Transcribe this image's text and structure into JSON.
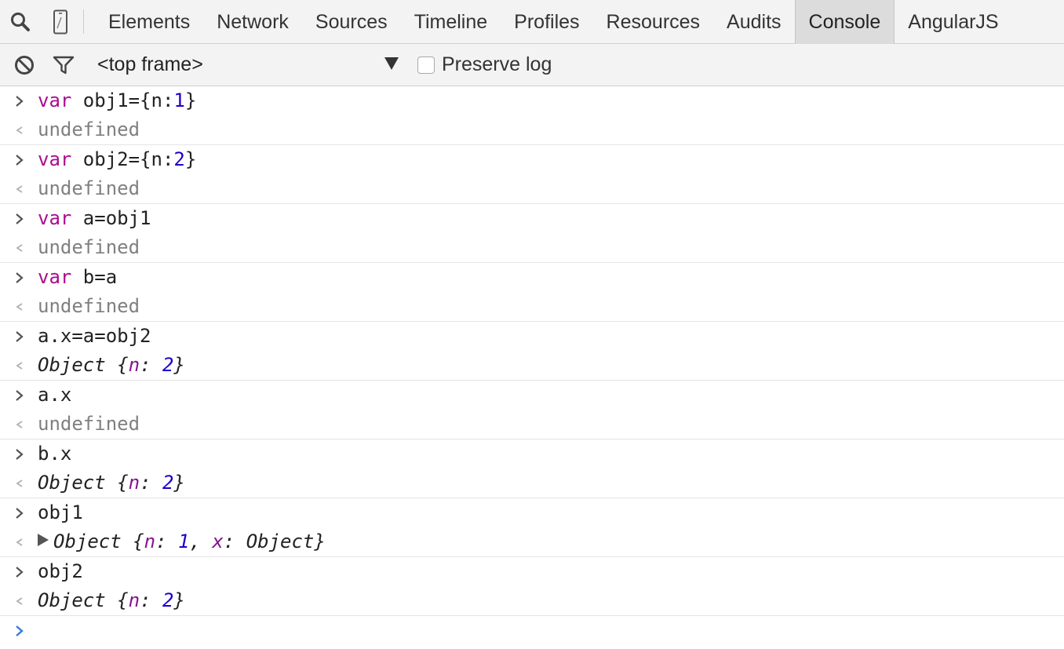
{
  "toolbar": {
    "icons": [
      "search-icon",
      "mobile-device-icon"
    ],
    "tabs": [
      {
        "label": "Elements"
      },
      {
        "label": "Network"
      },
      {
        "label": "Sources"
      },
      {
        "label": "Timeline"
      },
      {
        "label": "Profiles"
      },
      {
        "label": "Resources"
      },
      {
        "label": "Audits"
      },
      {
        "label": "Console",
        "active": true
      },
      {
        "label": "AngularJS"
      }
    ]
  },
  "filter_bar": {
    "frame_select": "<top frame>",
    "preserve_log_label": "Preserve log",
    "preserve_log_checked": false
  },
  "colors": {
    "keyword": "#aa0d91",
    "number": "#1c00cf",
    "property": "#881391",
    "undefined": "#808080",
    "prompt_active": "#3a7ad9"
  },
  "console": {
    "entries": [
      {
        "input": {
          "kw": "var",
          "text": " obj1={n:",
          "num": "1",
          "tail": "}"
        },
        "output": "undefined"
      },
      {
        "input": {
          "kw": "var",
          "text": " obj2={n:",
          "num": "2",
          "tail": "}"
        },
        "output": "undefined"
      },
      {
        "input": {
          "kw": "var",
          "text": " a=obj1"
        },
        "output": "undefined"
      },
      {
        "input": {
          "kw": "var",
          "text": " b=a"
        },
        "output": "undefined"
      },
      {
        "input": {
          "text": "a.x=a=obj2"
        },
        "output_obj": {
          "type": "Object",
          "props": [
            {
              "k": "n",
              "v": "2"
            }
          ]
        }
      },
      {
        "input": {
          "text": "a.x"
        },
        "output": "undefined"
      },
      {
        "input": {
          "text": "b.x"
        },
        "output_obj": {
          "type": "Object",
          "props": [
            {
              "k": "n",
              "v": "2"
            }
          ]
        }
      },
      {
        "input": {
          "text": "obj1"
        },
        "output_obj": {
          "type": "Object",
          "expandable": true,
          "props": [
            {
              "k": "n",
              "v": "1",
              "num": true
            },
            {
              "k": "x",
              "v": "Object"
            }
          ]
        }
      },
      {
        "input": {
          "text": "obj2"
        },
        "output_obj": {
          "type": "Object",
          "props": [
            {
              "k": "n",
              "v": "2"
            }
          ]
        }
      }
    ],
    "text": {
      "object_open": " {",
      "object_close": "}",
      "colon": ": ",
      "comma": ", "
    }
  }
}
